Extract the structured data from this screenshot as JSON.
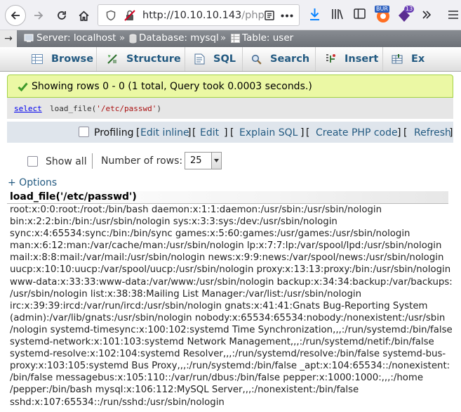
{
  "browser": {
    "url_host": "http://10.10.10.143",
    "url_path": "/php",
    "buttons": [
      "back",
      "forward",
      "reload",
      "home"
    ],
    "extension_badges": [
      {
        "name": "burp",
        "label": "BUR",
        "color": "#2b5fbf"
      },
      {
        "name": "extension",
        "label": "13",
        "color": "#6a3fb5"
      }
    ]
  },
  "breadcrumb": {
    "server": "Server: localhost",
    "database": "Database: mysql",
    "table": "Table: user",
    "separator": "»"
  },
  "tabs": [
    {
      "label": "Browse",
      "icon": "browse-icon"
    },
    {
      "label": "Structure",
      "icon": "structure-icon"
    },
    {
      "label": "SQL",
      "icon": "sql-icon"
    },
    {
      "label": "Search",
      "icon": "search-icon"
    },
    {
      "label": "Insert",
      "icon": "insert-icon"
    },
    {
      "label": "Ex",
      "icon": "export-icon"
    }
  ],
  "message": {
    "text": "Showing rows 0 - 0 (1 total, Query took 0.0003 seconds.)"
  },
  "query": {
    "keyword": "select",
    "func": "load_file(",
    "arg": "'/etc/passwd'",
    "close": ")"
  },
  "query_options": {
    "profiling_label": "Profiling",
    "open_bracket": "[",
    "close_bracket": "]",
    "links": [
      "Edit inline",
      "Edit",
      "Explain SQL",
      "Create PHP code",
      "Refresh"
    ]
  },
  "rows_control": {
    "show_all_label": "Show all",
    "number_of_rows_label": "Number of rows:",
    "number_of_rows_value": "25"
  },
  "options_link": "+ Options",
  "column_header": "load_file('/etc/passwd')",
  "result_lines": [
    "root:x:0:0:root:/root:/bin/bash daemon:x:1:1:daemon:/usr/sbin:/usr/sbin/nologin",
    "bin:x:2:2:bin:/bin:/usr/sbin/nologin sys:x:3:3:sys:/dev:/usr/sbin/nologin",
    "sync:x:4:65534:sync:/bin:/bin/sync games:x:5:60:games:/usr/games:/usr/sbin/nologin",
    "man:x:6:12:man:/var/cache/man:/usr/sbin/nologin lp:x:7:7:lp:/var/spool/lpd:/usr/sbin/nologin",
    "mail:x:8:8:mail:/var/mail:/usr/sbin/nologin news:x:9:9:news:/var/spool/news:/usr/sbin/nologin",
    "uucp:x:10:10:uucp:/var/spool/uucp:/usr/sbin/nologin proxy:x:13:13:proxy:/bin:/usr/sbin/nologin",
    "www-data:x:33:33:www-data:/var/www:/usr/sbin/nologin backup:x:34:34:backup:/var/backups:",
    "/usr/sbin/nologin list:x:38:38:Mailing List Manager:/var/list:/usr/sbin/nologin",
    "irc:x:39:39:ircd:/var/run/ircd:/usr/sbin/nologin gnats:x:41:41:Gnats Bug-Reporting System",
    "(admin):/var/lib/gnats:/usr/sbin/nologin nobody:x:65534:65534:nobody:/nonexistent:/usr/sbin",
    "/nologin systemd-timesync:x:100:102:systemd Time Synchronization,,,:/run/systemd:/bin/false",
    "systemd-network:x:101:103:systemd Network Management,,,:/run/systemd/netif:/bin/false",
    "systemd-resolve:x:102:104:systemd Resolver,,,:/run/systemd/resolve:/bin/false systemd-bus-",
    "proxy:x:103:105:systemd Bus Proxy,,,:/run/systemd:/bin/false _apt:x:104:65534::/nonexistent:",
    "/bin/false messagebus:x:105:110::/var/run/dbus:/bin/false pepper:x:1000:1000:,,,:/home",
    "/pepper:/bin/bash mysql:x:106:112:MySQL Server,,,:/nonexistent:/bin/false",
    "sshd:x:107:65534::/run/sshd:/usr/sbin/nologin"
  ],
  "colors": {
    "link": "#235a81",
    "success_bg": "#ebf8a4",
    "success_border": "#a2d246",
    "breadcrumb_bg": "#7b7f85"
  }
}
